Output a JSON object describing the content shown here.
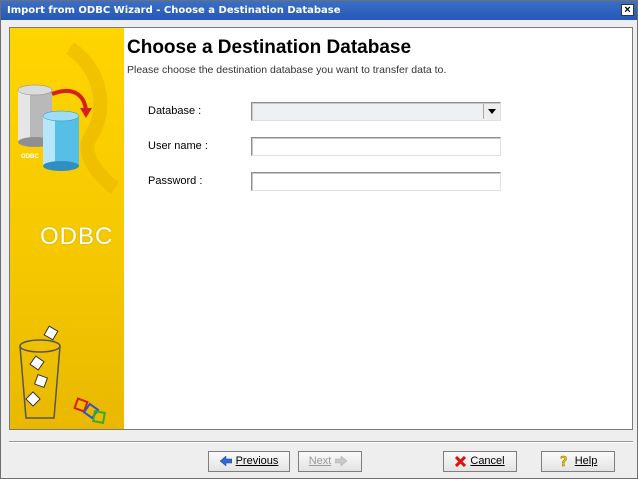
{
  "window": {
    "title": "Import from ODBC Wizard - Choose a Destination Database",
    "close_label": "×"
  },
  "sidebar": {
    "logo_text": "ODBC",
    "icon_label": "ODBC"
  },
  "page": {
    "heading": "Choose a Destination Database",
    "subheading": "Please choose the destination database you want to transfer data to."
  },
  "form": {
    "database_label": "Database :",
    "database_value": "",
    "username_label": "User name :",
    "username_value": "",
    "password_label": "Password :",
    "password_value": ""
  },
  "buttons": {
    "previous": "Previous",
    "next": "Next",
    "cancel": "Cancel",
    "help": "Help"
  },
  "colors": {
    "titlebar": "#2557b4",
    "sidebar": "#ffd500"
  }
}
